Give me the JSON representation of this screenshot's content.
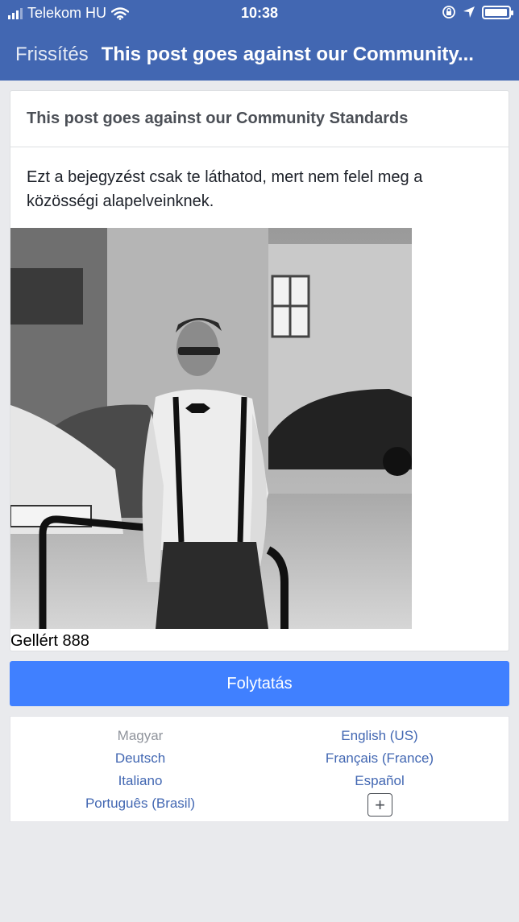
{
  "status_bar": {
    "carrier": "Telekom HU",
    "time": "10:38",
    "icons": [
      "signal-icon",
      "wifi-icon",
      "orientation-lock-icon",
      "location-arrow-icon",
      "battery-icon"
    ],
    "battery_level": 0.95
  },
  "nav": {
    "back_label": "Frissítés",
    "title": "This post goes against our Community..."
  },
  "card": {
    "header": "This post goes against our Community Standards",
    "message": "Ezt a bejegyzést csak te láthatod, mert nem felel meg a közösségi alapelveinknek.",
    "caption": "Gellért 888"
  },
  "continue_label": "Folytatás",
  "languages": {
    "items": [
      {
        "label": "Magyar",
        "current": true
      },
      {
        "label": "English (US)",
        "current": false
      },
      {
        "label": "Deutsch",
        "current": false
      },
      {
        "label": "Français (France)",
        "current": false
      },
      {
        "label": "Italiano",
        "current": false
      },
      {
        "label": "Español",
        "current": false
      },
      {
        "label": "Português (Brasil)",
        "current": false
      }
    ],
    "more_icon": "plus-icon",
    "more_symbol": "+"
  },
  "colors": {
    "header_blue": "#4267b2",
    "button_blue": "#4080ff",
    "link_blue": "#4267b2",
    "background": "#e9eaed"
  }
}
